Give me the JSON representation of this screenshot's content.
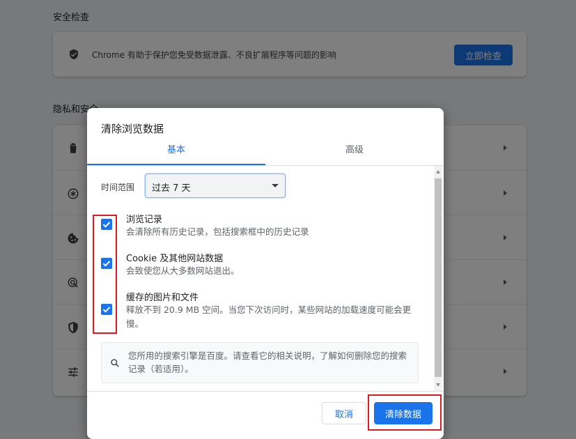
{
  "page": {
    "safety_check_title": "安全检查",
    "safety_check_text": "Chrome 有助于保护您免受数据泄露、不良扩展程序等问题的影响",
    "safety_check_button": "立即检查",
    "privacy_title": "隐私和安全",
    "privacy_rows": [
      {
        "icon": "trash-icon"
      },
      {
        "icon": "cookie-circle-icon"
      },
      {
        "icon": "cookie-icon"
      },
      {
        "icon": "security-target-icon"
      },
      {
        "icon": "shield-icon"
      },
      {
        "icon": "sliders-icon"
      }
    ]
  },
  "dialog": {
    "title": "清除浏览数据",
    "tabs": [
      {
        "label": "基本",
        "active": true
      },
      {
        "label": "高级",
        "active": false
      }
    ],
    "time_range_label": "时间范围",
    "time_range_value": "过去 7 天",
    "items": [
      {
        "title": "浏览记录",
        "desc": "会清除所有历史记录，包括搜索框中的历史记录",
        "checked": true
      },
      {
        "title": "Cookie 及其他网站数据",
        "desc": "会致使您从大多数网站退出。",
        "checked": true
      },
      {
        "title": "缓存的图片和文件",
        "desc": "释放不到 20.9 MB 空间。当您下次访问时，某些网站的加载速度可能会更慢。",
        "checked": true
      }
    ],
    "search_note": "您所用的搜索引擎是百度。请查看它的相关说明，了解如何删除您的搜索记录（若适用）。",
    "cancel_button": "取消",
    "clear_button": "清除数据"
  },
  "colors": {
    "accent": "#1a73e8",
    "highlight_red": "#e0191f",
    "scrim": "rgba(0,0,0,0.5)"
  }
}
